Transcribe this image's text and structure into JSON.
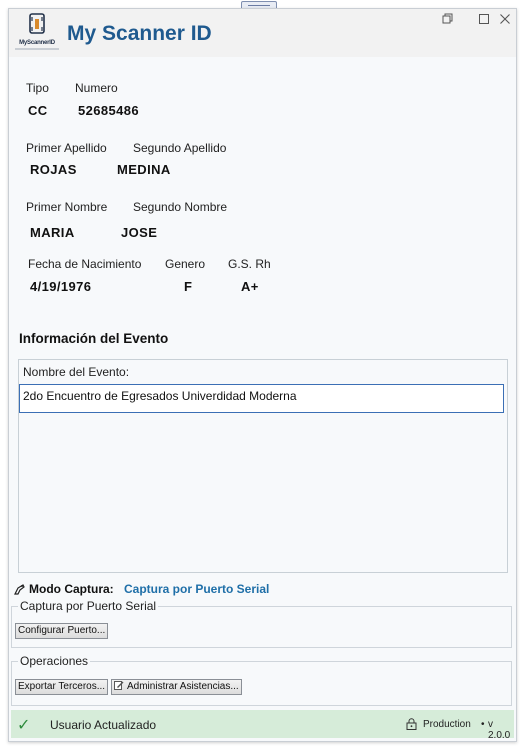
{
  "app": {
    "title": "My Scanner ID",
    "logo_text": "MyScannerID"
  },
  "window_controls": {
    "restore_icon": "restore-icon",
    "maximize_icon": "maximize-icon",
    "close_icon": "close-icon"
  },
  "document": {
    "tipo_label": "Tipo",
    "tipo_value": "CC",
    "numero_label": "Numero",
    "numero_value": "52685486",
    "primer_apellido_label": "Primer Apellido",
    "primer_apellido_value": "ROJAS",
    "segundo_apellido_label": "Segundo Apellido",
    "segundo_apellido_value": "MEDINA",
    "primer_nombre_label": "Primer Nombre",
    "primer_nombre_value": "MARIA",
    "segundo_nombre_label": "Segundo Nombre",
    "segundo_nombre_value": "JOSE",
    "fecha_label": "Fecha de Nacimiento",
    "fecha_value": "4/19/1976",
    "genero_label": "Genero",
    "genero_value": "F",
    "rh_label": "G.S. Rh",
    "rh_value": "A+"
  },
  "event": {
    "section_title": "Información del Evento",
    "name_label": "Nombre del Evento:",
    "name_value": "2do Encuentro de Egresados Univerdidad Moderna"
  },
  "capture": {
    "mode_label": "Modo Captura:",
    "mode_value": "Captura por Puerto Serial",
    "group_title": "Captura por Puerto Serial",
    "configure_button": "Configurar Puerto..."
  },
  "operations": {
    "group_title": "Operaciones",
    "export_button": "Exportar Terceros...",
    "manage_button": "Administrar Asistencias..."
  },
  "status": {
    "message": "Usuario Actualizado",
    "environment": "Production",
    "separator": "•",
    "version": "v 2.0.0"
  },
  "colors": {
    "accent": "#1f5a8f",
    "capture_mode": "#1f6fa8",
    "status_bg": "#d6ecd9",
    "status_check": "#2e8b3d"
  }
}
